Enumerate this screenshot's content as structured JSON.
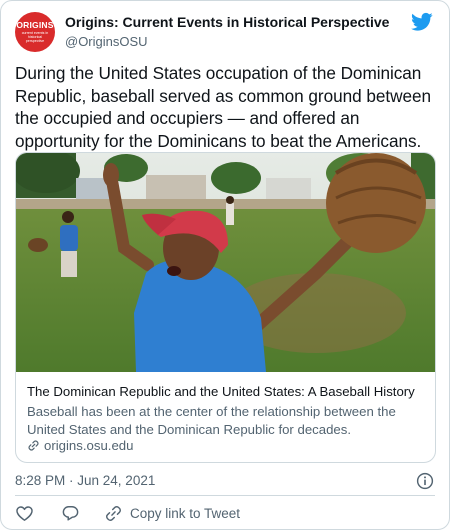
{
  "author": {
    "avatar_logo": "ORIGINS",
    "avatar_tagline": "current events in historical perspective",
    "name": "Origins: Current Events in Historical Perspective",
    "handle": "@OriginsOSU"
  },
  "brand_icon": "twitter-bird-icon",
  "tweet_text": "During the United States occupation of the Dominican Republic, baseball served as common ground between the occupied and occupiers — and offered an opportunity for the Dominicans to beat the Americans.",
  "link_card": {
    "image_icon": "photo-of-boy-with-baseball-glove",
    "title": "The Dominican Republic and the United States: A Baseball History",
    "description": "Baseball has been at the center of the relationship between the United States and the Dominican Republic for decades.",
    "domain": "origins.osu.edu"
  },
  "timestamp": "8:28 PM · Jun 24, 2021",
  "actions": {
    "like_icon": "heart-icon",
    "reply_icon": "reply-icon",
    "copy_label": "Copy link to Tweet"
  },
  "colors": {
    "text_primary": "#0f1419",
    "text_secondary": "#536471",
    "border": "#cfd9de",
    "twitter_blue": "#1d9bf0",
    "avatar_red": "#d92b2b"
  }
}
